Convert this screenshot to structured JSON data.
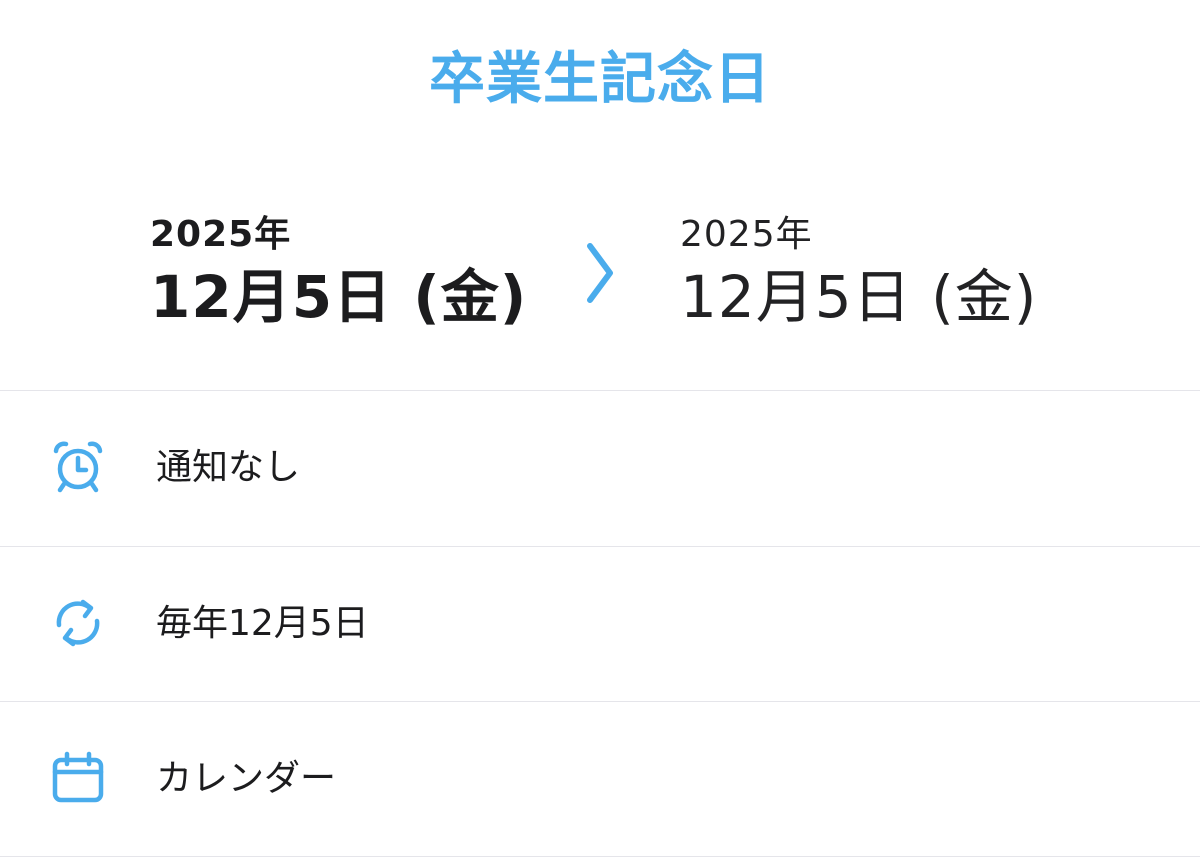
{
  "header": {
    "title": "卒業生記念日"
  },
  "date_range": {
    "start": {
      "year": "2025年",
      "day": "12月5日 (金)"
    },
    "end": {
      "year": "2025年",
      "day": "12月5日 (金)"
    },
    "arrow_icon": "chevron-right-icon"
  },
  "rows": [
    {
      "icon": "alarm-clock-icon",
      "label": "通知なし"
    },
    {
      "icon": "repeat-icon",
      "label": "毎年12月5日"
    },
    {
      "icon": "calendar-icon",
      "label": "カレンダー"
    }
  ],
  "colors": {
    "accent": "#4aacec",
    "text": "#1c1c1e",
    "divider": "#e5e5ea"
  }
}
